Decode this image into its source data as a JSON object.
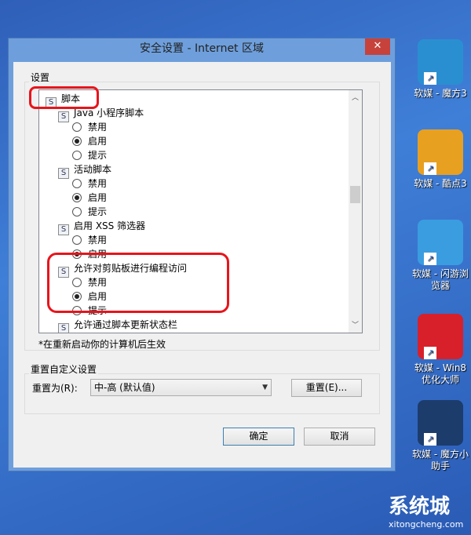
{
  "window": {
    "title": "安全设置 - Internet 区域",
    "close": "✕"
  },
  "settings": {
    "label": "设置",
    "rows": [
      {
        "type": "category",
        "text": "脚本"
      },
      {
        "type": "item",
        "text": "Java 小程序脚本"
      },
      {
        "type": "option",
        "text": "禁用",
        "checked": false
      },
      {
        "type": "option",
        "text": "启用",
        "checked": true
      },
      {
        "type": "option",
        "text": "提示",
        "checked": false
      },
      {
        "type": "item",
        "text": "活动脚本"
      },
      {
        "type": "option",
        "text": "禁用",
        "checked": false
      },
      {
        "type": "option",
        "text": "启用",
        "checked": true
      },
      {
        "type": "option",
        "text": "提示",
        "checked": false
      },
      {
        "type": "item",
        "text": "启用 XSS 筛选器"
      },
      {
        "type": "option",
        "text": "禁用",
        "checked": false
      },
      {
        "type": "option",
        "text": "启用",
        "checked": true
      },
      {
        "type": "item",
        "text": "允许对剪贴板进行编程访问"
      },
      {
        "type": "option",
        "text": "禁用",
        "checked": false
      },
      {
        "type": "option",
        "text": "启用",
        "checked": true
      },
      {
        "type": "option",
        "text": "提示",
        "checked": false
      },
      {
        "type": "item",
        "text": "允许通过脚本更新状态栏"
      }
    ],
    "note": "*在重新启动你的计算机后生效"
  },
  "reset": {
    "label": "重置自定义设置",
    "reset_to": "重置为(R):",
    "value": "中-高 (默认值)",
    "button": "重置(E)..."
  },
  "buttons": {
    "ok": "确定",
    "cancel": "取消"
  },
  "desktop": [
    {
      "label": "软媒 - 魔方3",
      "color": "#2a8fd0"
    },
    {
      "label": "软媒 - 酷点3",
      "color": "#e8a020"
    },
    {
      "label": "软媒 - 闪游浏览器",
      "color": "#3a9de0"
    },
    {
      "label": "软媒 - Win8优化大师",
      "color": "#d8202a"
    },
    {
      "label": "软媒 - 魔方小助手",
      "color": "#1c3c6c"
    }
  ],
  "watermark": {
    "name": "系统城",
    "url": "xitongcheng.com"
  },
  "highlight_color": "#e8141b"
}
